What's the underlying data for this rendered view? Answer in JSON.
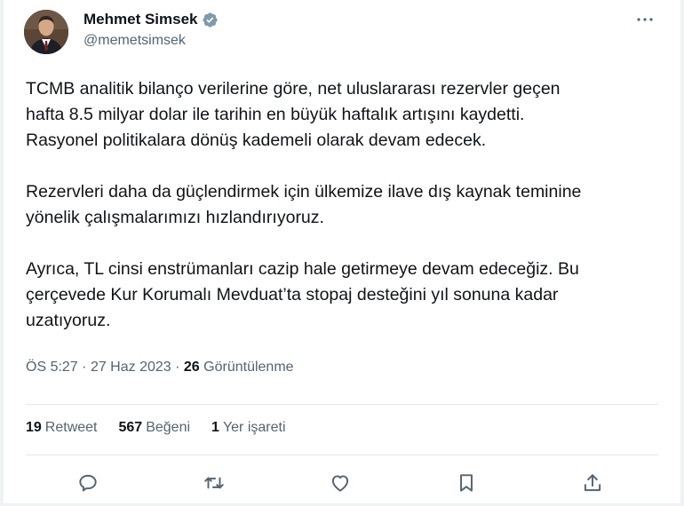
{
  "author": {
    "display_name": "Mehmet Simsek",
    "handle": "@memetsimsek",
    "verified": true
  },
  "tweet": {
    "paragraphs": [
      "TCMB analitik bilanço verilerine göre, net uluslararası rezervler geçen\nhafta 8.5 milyar dolar ile tarihin en büyük haftalık artışını kaydetti.\nRasyonel politikalara dönüş kademeli olarak devam edecek.",
      "Rezervleri daha da güçlendirmek için ülkemize ilave dış kaynak teminine\nyönelik çalışmalarımızı hızlandırıyoruz.",
      "Ayrıca, TL cinsi enstrümanları cazip hale getirmeye devam edeceğiz. Bu\nçerçevede Kur Korumalı Mevduat’ta stopaj desteğini yıl sonuna kadar\nuzatıyoruz."
    ]
  },
  "meta": {
    "time": "ÖS 5:27",
    "separator": "·",
    "date": "27 Haz 2023",
    "views_count": "26",
    "views_label": "Görüntülenme"
  },
  "stats": [
    {
      "count": "19",
      "label": "Retweet"
    },
    {
      "count": "567",
      "label": "Beğeni"
    },
    {
      "count": "1",
      "label": "Yer işareti"
    }
  ],
  "actions": [
    "reply-icon",
    "retweet-icon",
    "like-icon",
    "bookmark-icon",
    "share-icon"
  ],
  "colors": {
    "text": "#0f1419",
    "secondary": "#536471",
    "verified": "#829aab",
    "divider": "#e4e8ea"
  }
}
